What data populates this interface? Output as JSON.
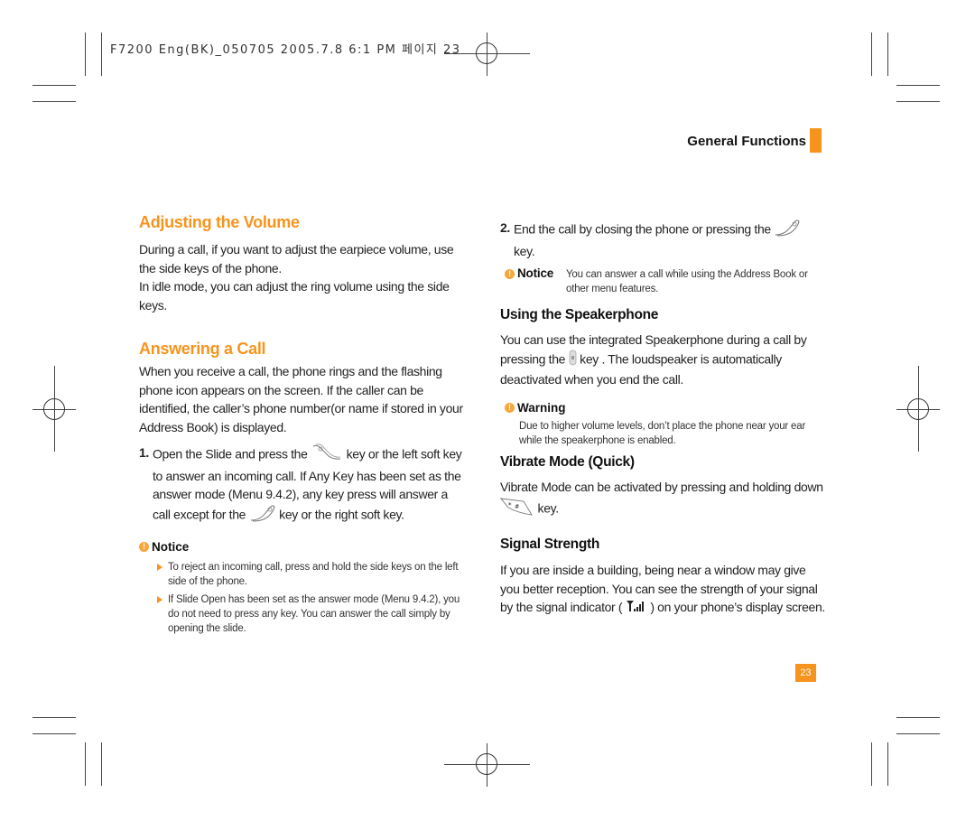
{
  "slug_line": "F7200 Eng(BK)_050705  2005.7.8  6:1 PM 페이지 23",
  "section_header": "General Functions",
  "page_number": "23",
  "colors": {
    "accent": "#f7941d",
    "text": "#222222"
  },
  "left": {
    "adjust": {
      "title": "Adjusting the Volume",
      "para1": "During a call, if you want to adjust the earpiece volume, use the side keys of the phone.",
      "para2": "In idle mode, you can adjust the ring volume using the side keys."
    },
    "answer": {
      "title": "Answering a Call",
      "para": "When you receive a call, the phone rings and the flashing phone icon appears on the screen. If the caller can be identified, the caller’s phone number(or name if stored in your Address Book) is displayed.",
      "step1": {
        "num": "1.",
        "part1": "Open the Slide and press the",
        "icon1": "send-key-icon",
        "part2": "key or the left soft key to answer an incoming call. If Any Key has been set as the answer mode (Menu 9.4.2), any key press will answer a call except for the",
        "icon2": "end-key-icon",
        "part3": "key or the right soft key."
      },
      "notice": {
        "title": "Notice",
        "bullets": [
          "To reject an incoming call, press and hold the side keys on the left side of the phone.",
          "If Slide Open has been set as the answer mode (Menu 9.4.2), you do not need to press any key. You can answer the call simply by opening the slide."
        ]
      }
    }
  },
  "right": {
    "step2": {
      "num": "2.",
      "part1": "End the call by closing the phone or pressing the",
      "icon": "end-key-icon",
      "part2": "key."
    },
    "notice2": {
      "title": "Notice",
      "text": "You can answer a call while using the Address Book or other menu features."
    },
    "speaker": {
      "title": "Using the Speakerphone",
      "part1": "You can use the integrated Speakerphone during a call by pressing the",
      "icon": "side-key-icon",
      "part2": "key . The loudspeaker is automatically deactivated when you end the call.",
      "warning_title": "Warning",
      "warning_text": "Due to higher volume levels, don’t place the phone near your ear while the speakerphone is enabled."
    },
    "vibrate": {
      "title": "Vibrate Mode (Quick)",
      "part1": "Vibrate Mode can be activated by pressing and holding down",
      "icon": "star-key-icon",
      "part2": "key."
    },
    "signal": {
      "title": "Signal Strength",
      "part1": "If you are inside a building, being near a window may give you better reception. You can see the strength of your signal by the signal indicator (",
      "icon": "signal-strength-icon",
      "part2": ") on your phone’s display screen."
    }
  }
}
